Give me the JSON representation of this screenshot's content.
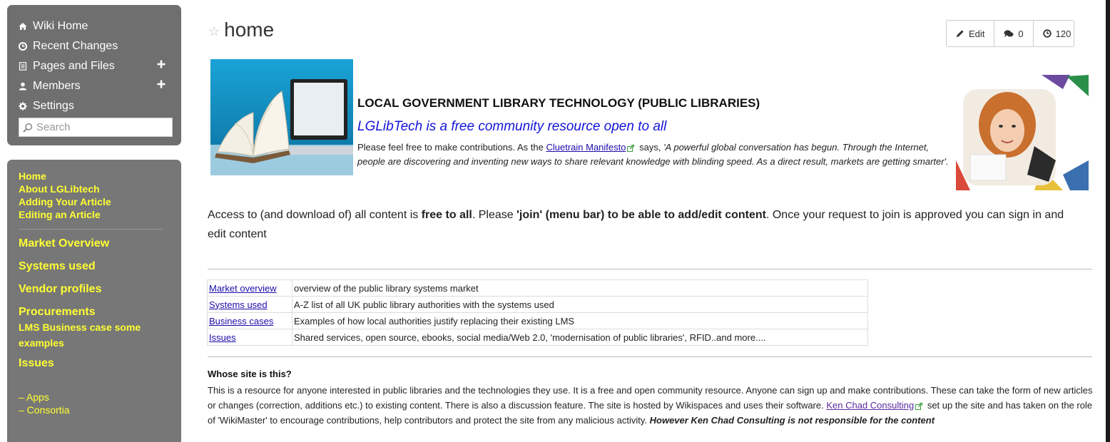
{
  "nav": {
    "items": [
      {
        "label": "Wiki Home",
        "icon": "home-icon"
      },
      {
        "label": "Recent Changes",
        "icon": "clock-icon"
      },
      {
        "label": "Pages and Files",
        "icon": "file-icon",
        "plus": true
      },
      {
        "label": "Members",
        "icon": "user-icon",
        "plus": true
      },
      {
        "label": "Settings",
        "icon": "gear-icon"
      }
    ],
    "search_placeholder": "Search"
  },
  "sidebar_links": {
    "top": [
      "Home",
      "About LGLibtech",
      "Adding Your Article",
      "Editing an Article"
    ],
    "market_overview": "Market Overview",
    "systems_used": "Systems used",
    "vendor_profiles": "Vendor profiles",
    "procurements": "Procurements",
    "lms_business_case": "LMS Business case some examples",
    "issues": "Issues",
    "apps": "– Apps",
    "consortia": "– Consortia"
  },
  "page": {
    "title": "home",
    "edit_label": "Edit",
    "comments_count": "0",
    "history_count": "120"
  },
  "hero": {
    "org_title": "LOCAL GOVERNMENT LIBRARY TECHNOLOGY (PUBLIC LIBRARIES)",
    "tagline": "LGLibTech is a free community resource open to all",
    "intro_pre": "Please feel free to make contributions. As the ",
    "intro_link": "Cluetrain Manifesto",
    "intro_mid": " says, ",
    "intro_quote": "'A powerful global conversation has begun. Through the Internet, people are discovering and inventing new ways to share relevant knowledge with blinding speed. As a direct result, markets are getting smarter'."
  },
  "access": {
    "p1": "Access to (and download of) all content is ",
    "b1": "free to all",
    "p2": ". Please ",
    "b2": "'join' (menu bar) to be able to add/edit content",
    "p3": ". Once your request to join is approved you can sign in and edit content"
  },
  "topics": [
    {
      "link": "Market overview",
      "desc": "overview of the public library systems market"
    },
    {
      "link": "Systems used",
      "desc": "A-Z list of all UK public library authorities with the systems used"
    },
    {
      "link": "Business cases",
      "desc": "Examples of how local authorities justify replacing their existing LMS"
    },
    {
      "link": "Issues",
      "desc": "Shared services, open source, ebooks, social media/Web 2.0, 'modernisation of public libraries', RFID..and more...."
    }
  ],
  "whose": {
    "heading": "Whose site is this?",
    "p1": "This is a resource for anyone interested in public libraries and the technologies they use. It is a free and open community resource. Anyone can sign up and make contributions. These can take the form of new articles or changes (correction, additions etc.) to existing content. There is also a discussion feature. The site is hosted by Wikispaces and uses their software. ",
    "link": "Ken Chad Consulting",
    "p2": " set up the site and has taken on the role of 'WikiMaster' to encourage contributions, help contributors and protect the site from any malicious activity. ",
    "b": "However Ken Chad Consulting is not responsible for the content"
  }
}
